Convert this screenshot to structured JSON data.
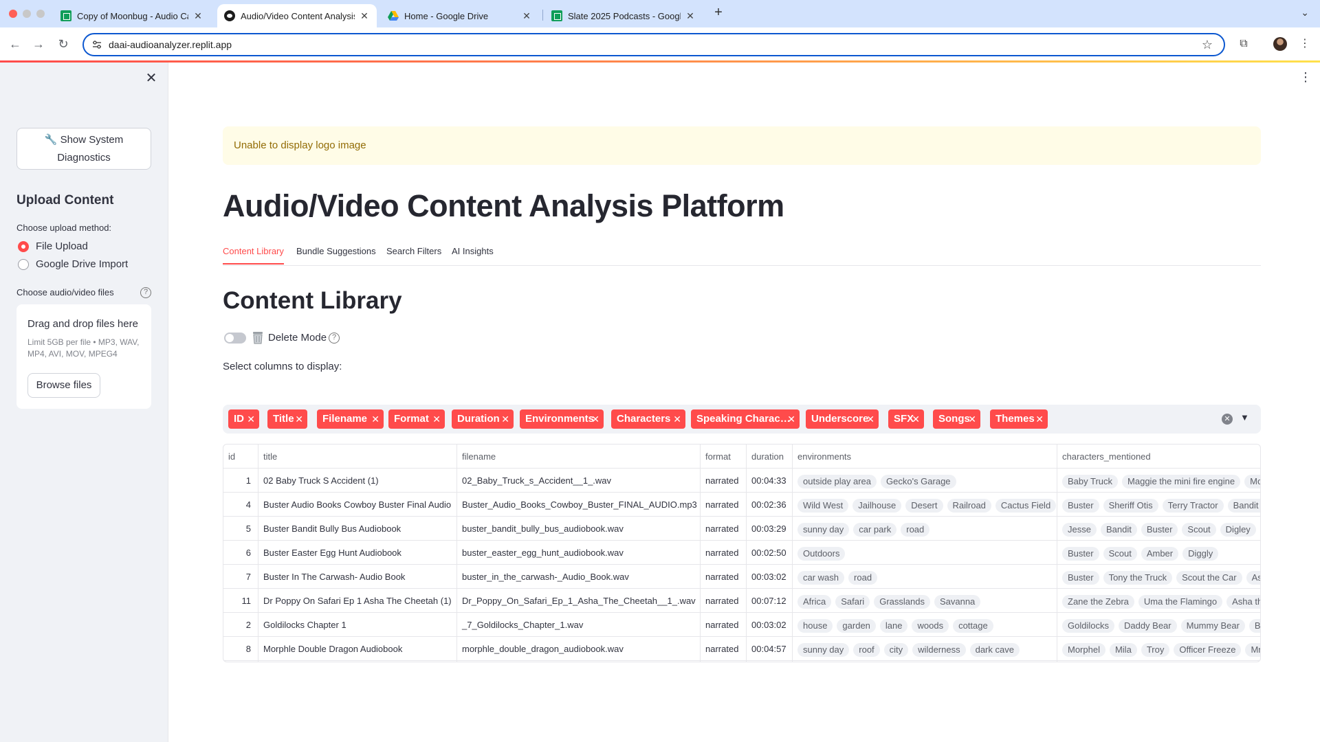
{
  "browser": {
    "tabs": [
      {
        "title": "Copy of Moonbug - Audio Ca",
        "favicon": "sheets-icon"
      },
      {
        "title": "Audio/Video Content Analysis",
        "favicon": "replit-icon"
      },
      {
        "title": "Home - Google Drive",
        "favicon": "drive-icon"
      },
      {
        "title": "Slate 2025 Podcasts - Googl",
        "favicon": "sheets-icon"
      }
    ],
    "url": "daai-audioanalyzer.replit.app"
  },
  "sidebar": {
    "diagnostics_button": "🔧 Show System Diagnostics",
    "heading": "Upload Content",
    "upload_method_label": "Choose upload method:",
    "upload_options": [
      "File Upload",
      "Google Drive Import"
    ],
    "selected_option": "File Upload",
    "files_label": "Choose audio/video files",
    "dropzone": {
      "title": "Drag and drop files here",
      "limit": "Limit 5GB per file • MP3, WAV, MP4, AVI, MOV, MPEG4",
      "browse_label": "Browse files"
    }
  },
  "main": {
    "alert": "Unable to display logo image",
    "title": "Audio/Video Content Analysis Platform",
    "tabs": [
      "Content Library",
      "Bundle Suggestions",
      "Search Filters",
      "AI Insights"
    ],
    "active_tab": "Content Library",
    "section_title": "Content Library",
    "delete_mode_label": "Delete Mode",
    "columns_label": "Select columns to display:",
    "selected_columns": [
      "ID",
      "Title",
      "Filename",
      "Format",
      "Duration",
      "Environments",
      "Characters",
      "Speaking Charac…",
      "Underscore",
      "SFX",
      "Songs",
      "Themes"
    ]
  },
  "table": {
    "headers": [
      "id",
      "title",
      "filename",
      "format",
      "duration",
      "environments",
      "characters_mentioned"
    ],
    "rows": [
      {
        "id": "1",
        "title": "02 Baby Truck S Accident (1)",
        "filename": "02_Baby_Truck_s_Accident__1_.wav",
        "format": "narrated",
        "duration": "00:04:33",
        "environments": [
          "outside play area",
          "Gecko's Garage"
        ],
        "characters": [
          "Baby Truck",
          "Maggie the mini fire engine",
          "Mo"
        ]
      },
      {
        "id": "4",
        "title": "Buster Audio Books Cowboy Buster Final Audio",
        "filename": "Buster_Audio_Books_Cowboy_Buster_FINAL_AUDIO.mp3",
        "format": "narrated",
        "duration": "00:02:36",
        "environments": [
          "Wild West",
          "Jailhouse",
          "Desert",
          "Railroad",
          "Cactus Field"
        ],
        "characters": [
          "Buster",
          "Sheriff Otis",
          "Terry Tractor",
          "Bandit I"
        ]
      },
      {
        "id": "5",
        "title": "Buster Bandit Bully Bus Audiobook",
        "filename": "buster_bandit_bully_bus_audiobook.wav",
        "format": "narrated",
        "duration": "00:03:29",
        "environments": [
          "sunny day",
          "car park",
          "road"
        ],
        "characters": [
          "Jesse",
          "Bandit",
          "Buster",
          "Scout",
          "Digley",
          "G"
        ]
      },
      {
        "id": "6",
        "title": "Buster Easter Egg Hunt Audiobook",
        "filename": "buster_easter_egg_hunt_audiobook.wav",
        "format": "narrated",
        "duration": "00:02:50",
        "environments": [
          "Outdoors"
        ],
        "characters": [
          "Buster",
          "Scout",
          "Amber",
          "Diggly"
        ]
      },
      {
        "id": "7",
        "title": "Buster In The Carwash- Audio Book",
        "filename": "buster_in_the_carwash-_Audio_Book.wav",
        "format": "narrated",
        "duration": "00:03:02",
        "environments": [
          "car wash",
          "road"
        ],
        "characters": [
          "Buster",
          "Tony the Truck",
          "Scout the Car",
          "Ash"
        ]
      },
      {
        "id": "11",
        "title": "Dr Poppy On Safari Ep 1 Asha The Cheetah (1)",
        "filename": "Dr_Poppy_On_Safari_Ep_1_Asha_The_Cheetah__1_.wav",
        "format": "narrated",
        "duration": "00:07:12",
        "environments": [
          "Africa",
          "Safari",
          "Grasslands",
          "Savanna"
        ],
        "characters": [
          "Zane the Zebra",
          "Uma the Flamingo",
          "Asha the"
        ]
      },
      {
        "id": "2",
        "title": "Goldilocks Chapter 1",
        "filename": "_7_Goldilocks_Chapter_1.wav",
        "format": "narrated",
        "duration": "00:03:02",
        "environments": [
          "house",
          "garden",
          "lane",
          "woods",
          "cottage"
        ],
        "characters": [
          "Goldilocks",
          "Daddy Bear",
          "Mummy Bear",
          "Ba"
        ]
      },
      {
        "id": "8",
        "title": "Morphle Double Dragon Audiobook",
        "filename": "morphle_double_dragon_audiobook.wav",
        "format": "narrated",
        "duration": "00:04:57",
        "environments": [
          "sunny day",
          "roof",
          "city",
          "wilderness",
          "dark cave"
        ],
        "characters": [
          "Morphel",
          "Mila",
          "Troy",
          "Officer Freeze",
          "Mr. V"
        ]
      }
    ]
  },
  "colors": {
    "accent": "#ff4b4b",
    "sidebar_bg": "#f0f2f6",
    "alert_bg": "#fffce7",
    "alert_text": "#926c05",
    "omnibox_border": "#0b57d0"
  }
}
